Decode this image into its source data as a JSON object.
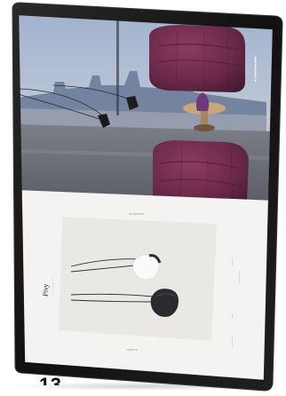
{
  "screen": {
    "hero": {
      "brand_mark": "●  ●●●●●●●●●"
    },
    "divider_caption": "━━  ━━━━━━━",
    "product": {
      "name": "Pivy",
      "subtitle": "────────────",
      "specs": [
        "─────",
        "────────",
        "───",
        "───────"
      ],
      "caption": "━━━━━  ━"
    }
  },
  "page_number": "13",
  "colors": {
    "bezel": "#141414",
    "sofa": "#6b2a48",
    "page_bg": "#f4f3f1",
    "card_bg": "#e9e8e5"
  }
}
